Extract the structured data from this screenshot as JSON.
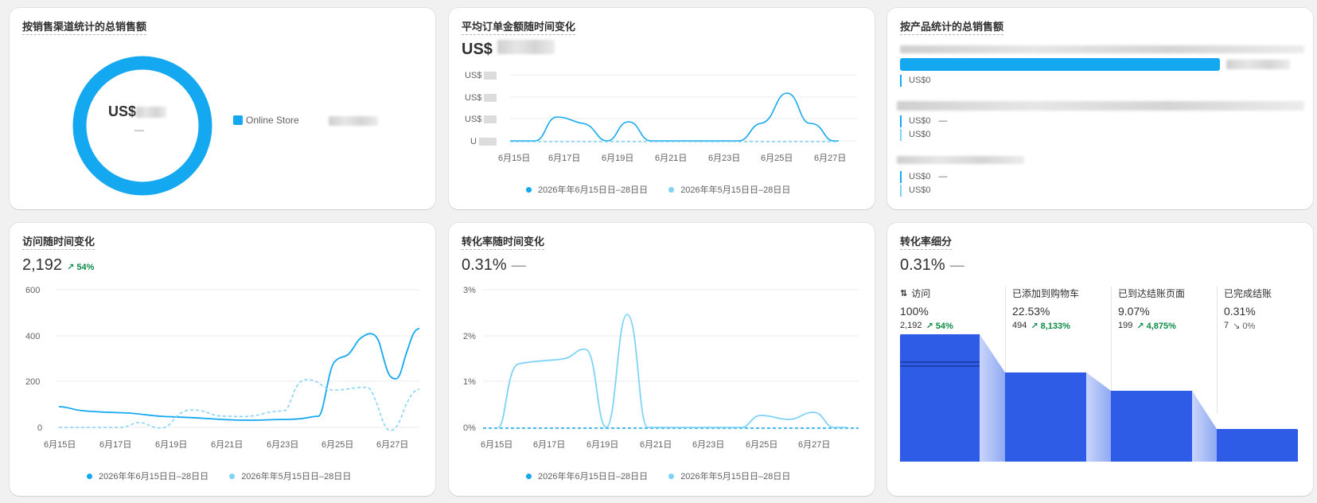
{
  "cards": {
    "sales_by_channel": {
      "title": "按销售渠道统计的总销售额",
      "center_value_prefix": "US$",
      "center_sub": "—",
      "legend_label": "Online Store",
      "ring_color": "#13a8ef"
    },
    "aov": {
      "title": "平均订单金额随时间变化",
      "value_prefix": "US$",
      "y_ticks": [
        "US$",
        "US$",
        "US$",
        "U"
      ],
      "x_ticks": [
        "6月15日",
        "6月17日",
        "6月19日",
        "6月21日",
        "6月23日",
        "6月25日",
        "6月27日"
      ],
      "legend": [
        "2026年年6月15日日–28日日",
        "2026年年5月15日日–28日日"
      ]
    },
    "sales_by_product": {
      "title": "按产品统计的总销售额",
      "rows": [
        {
          "values": [
            "US$0"
          ]
        },
        {
          "values": [
            "US$0",
            "US$0"
          ],
          "dash": "—"
        },
        {
          "values": [
            "US$0",
            "US$0"
          ],
          "dash": "—"
        }
      ],
      "bar_color": "#13a8ef"
    },
    "visits": {
      "title": "访问随时间变化",
      "value": "2,192",
      "delta": "↗ 54%",
      "x_ticks": [
        "6月15日",
        "6月17日",
        "6月19日",
        "6月21日",
        "6月23日",
        "6月25日",
        "6月27日"
      ],
      "y_ticks": [
        "600",
        "400",
        "200",
        "0"
      ],
      "legend": [
        "2026年年6月15日日–28日日",
        "2026年年5月15日日–28日日"
      ]
    },
    "conversion": {
      "title": "转化率随时间变化",
      "value": "0.31%",
      "dash": "—",
      "x_ticks": [
        "6月15日",
        "6月17日",
        "6月19日",
        "6月21日",
        "6月23日",
        "6月25日",
        "6月27日"
      ],
      "y_ticks": [
        "3%",
        "2%",
        "1%",
        "0%"
      ],
      "legend": [
        "2026年年6月15日日–28日日",
        "2026年年5月15日日–28日日"
      ]
    },
    "funnel": {
      "title": "转化率细分",
      "value": "0.31%",
      "dash": "—",
      "steps": [
        {
          "label": "访问",
          "pct": "100%",
          "count": "2,192",
          "delta": "↗ 54%",
          "dir": "up",
          "icon": "sort-arrows-icon"
        },
        {
          "label": "已添加到购物车",
          "pct": "22.53%",
          "count": "494",
          "delta": "↗ 8,133%",
          "dir": "up"
        },
        {
          "label": "已到达结账页面",
          "pct": "9.07%",
          "count": "199",
          "delta": "↗ 4,875%",
          "dir": "up"
        },
        {
          "label": "已完成结账",
          "pct": "0.31%",
          "count": "7",
          "delta": "↘ 0%",
          "dir": "down"
        }
      ],
      "bar_color": "#2e5ce6"
    }
  },
  "series_colors": {
    "current": "#13a8ef",
    "previous": "#7ed3f7"
  }
}
